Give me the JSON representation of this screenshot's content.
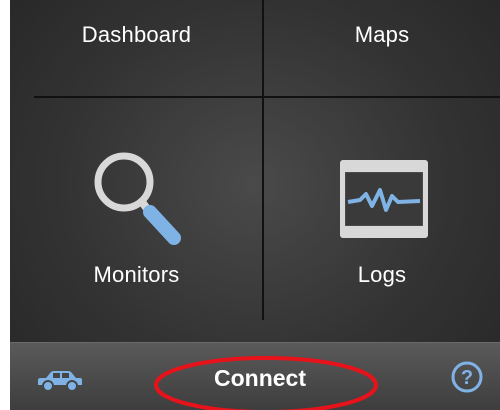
{
  "tiles": {
    "dashboard": "Dashboard",
    "maps": "Maps",
    "monitors": "Monitors",
    "logs": "Logs"
  },
  "bottom_bar": {
    "connect_label": "Connect",
    "left_icon": "car-icon",
    "right_icon": "help-icon"
  },
  "colors": {
    "background": "#333333",
    "accent_blue": "#7fb3e6",
    "highlight_red": "#e8121b",
    "text": "#ffffff"
  }
}
